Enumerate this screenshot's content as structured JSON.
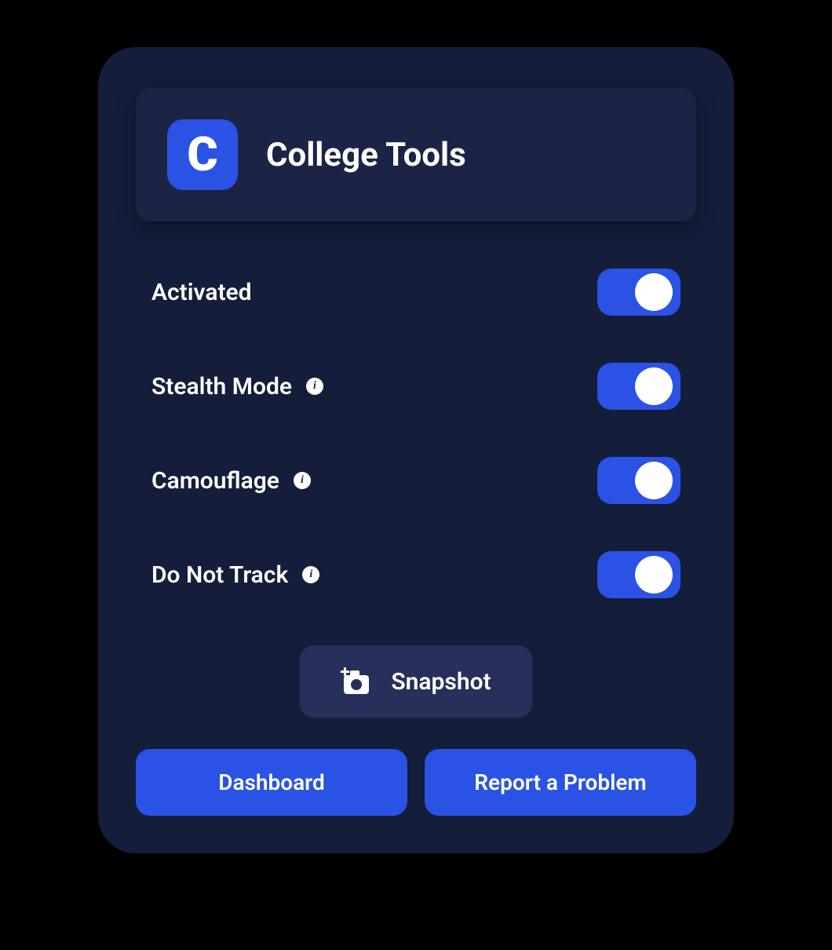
{
  "header": {
    "logo_letter": "C",
    "title": "College Tools"
  },
  "settings": [
    {
      "label": "Activated",
      "has_info": false,
      "toggled": true
    },
    {
      "label": "Stealth Mode",
      "has_info": true,
      "toggled": true
    },
    {
      "label": "Camouflage",
      "has_info": true,
      "toggled": true
    },
    {
      "label": "Do Not Track",
      "has_info": true,
      "toggled": true
    }
  ],
  "snapshot": {
    "label": "Snapshot"
  },
  "buttons": {
    "dashboard": "Dashboard",
    "report": "Report a Problem"
  },
  "colors": {
    "accent": "#2a52e5",
    "panel": "#141d3a",
    "header_bg": "#1b2444",
    "snapshot_bg": "#27305a"
  }
}
